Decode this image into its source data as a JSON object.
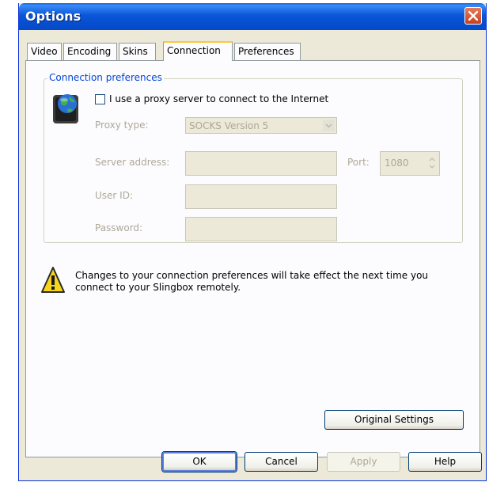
{
  "window": {
    "title": "Options"
  },
  "tabs": [
    "Video",
    "Encoding",
    "Skins",
    "Connection",
    "Preferences"
  ],
  "active_tab": "Connection",
  "connection": {
    "group_label": "Connection preferences",
    "proxy_checkbox_label": "I use a proxy server to connect to the Internet",
    "proxy_checked": false,
    "proxy_type_label": "Proxy type:",
    "proxy_type_value": "SOCKS Version 5",
    "server_address_label": "Server address:",
    "server_address_value": "",
    "port_label": "Port:",
    "port_value": "1080",
    "user_id_label": "User ID:",
    "user_id_value": "",
    "password_label": "Password:",
    "password_value": "",
    "warning_text": "Changes to your connection preferences will take effect the next time you connect to your Slingbox remotely.",
    "original_settings_label": "Original Settings"
  },
  "buttons": {
    "ok": "OK",
    "cancel": "Cancel",
    "apply": "Apply",
    "help": "Help"
  },
  "icons": {
    "close": "close-icon",
    "globe": "globe-icon",
    "warning": "warning-icon"
  },
  "colors": {
    "titlebar": "#0a55d8",
    "group_label": "#0046d5",
    "disabled_text": "#aca899",
    "active_tab_accent": "#ffc83c"
  }
}
